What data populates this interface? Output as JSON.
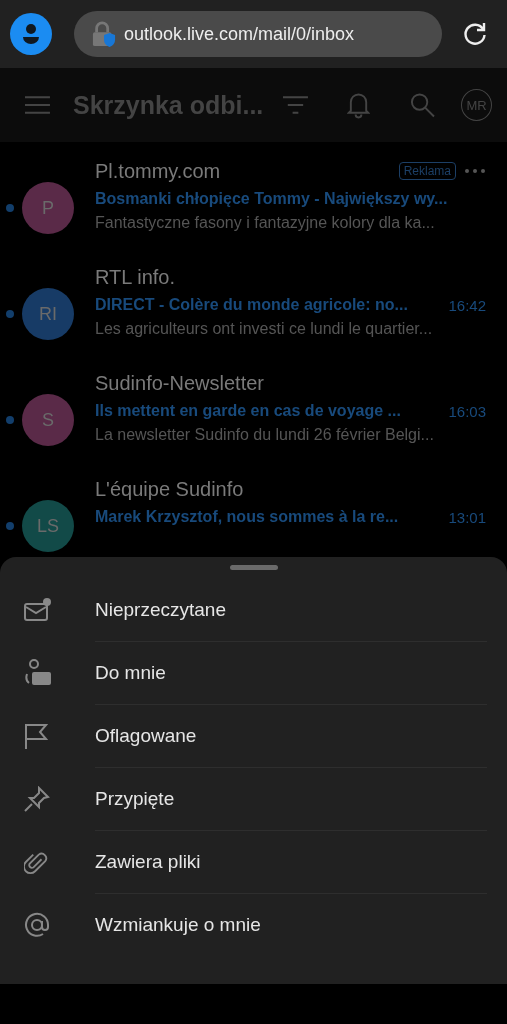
{
  "browser": {
    "url": "outlook.live.com/mail/0/inbox"
  },
  "header": {
    "title": "Skrzynka odbi...",
    "avatar": "MR"
  },
  "messages": [
    {
      "initials": "P",
      "color": "#5a2a48",
      "sender": "Pl.tommy.com",
      "subject": "Bosmanki chłopięce Tommy - Największy wy...",
      "preview": "Fantastyczne fasony i fantazyjne kolory dla ka...",
      "badge": "Reklama",
      "unread": true
    },
    {
      "initials": "RI",
      "color": "#173b66",
      "sender": "RTL info.",
      "subject": "DIRECT - Colère du monde agricole: no...",
      "time": "16:42",
      "preview": "Les agriculteurs ont investi ce lundi le quartier...",
      "unread": true
    },
    {
      "initials": "S",
      "color": "#5a2a48",
      "sender": "Sudinfo-Newsletter",
      "subject": "Ils mettent en garde en cas de voyage ...",
      "time": "16:03",
      "preview": "La newsletter Sudinfo du lundi 26 février Belgi...",
      "unread": true
    },
    {
      "initials": "LS",
      "color": "#124a48",
      "sender": "L'équipe Sudinfo",
      "subject": "Marek Krzysztof, nous sommes à la re...",
      "time": "13:01",
      "unread": true
    }
  ],
  "filter_menu": [
    {
      "label": "Nieprzeczytane"
    },
    {
      "label": "Do mnie"
    },
    {
      "label": "Oflagowane"
    },
    {
      "label": "Przypięte"
    },
    {
      "label": "Zawiera pliki"
    },
    {
      "label": "Wzmiankuje o mnie"
    }
  ]
}
